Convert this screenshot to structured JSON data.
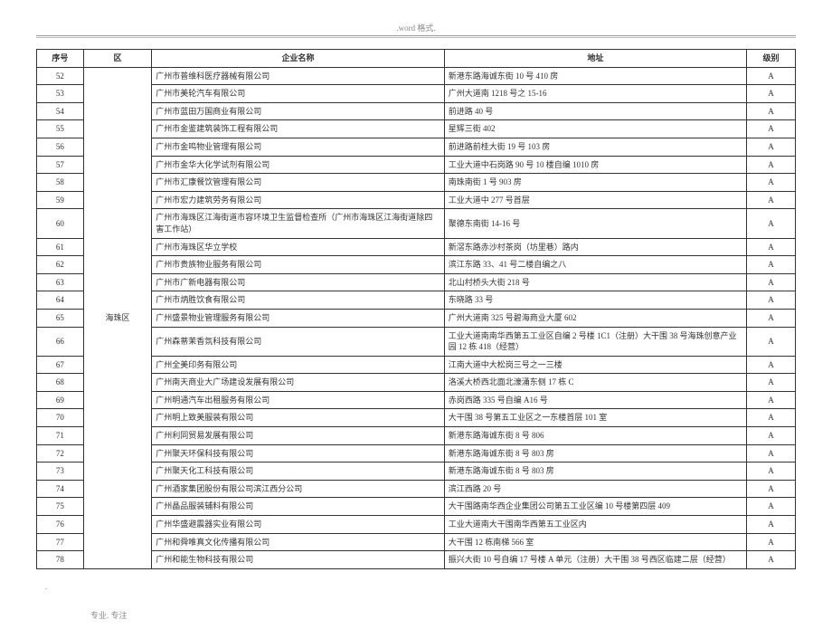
{
  "header_note": ".word 格式.",
  "footer_dot": ".",
  "footer_note": "专业. 专注",
  "columns": {
    "seq": "序号",
    "district": "区",
    "name": "企业名称",
    "addr": "地址",
    "level": "级别"
  },
  "district_label": "海珠区",
  "rows": [
    {
      "seq": "52",
      "name": "广州市普维科医疗器械有限公司",
      "addr": "新港东路海诚东街 10 号 410 房",
      "level": "A"
    },
    {
      "seq": "53",
      "name": "广州市美轮汽车有限公司",
      "addr": "广州大道南 1218 号之 15-16",
      "level": "A"
    },
    {
      "seq": "54",
      "name": "广州市蓝田万国商业有限公司",
      "addr": "前进路 40 号",
      "level": "A"
    },
    {
      "seq": "55",
      "name": "广州市金鉴建筑装饰工程有限公司",
      "addr": "星辉三街 402",
      "level": "A"
    },
    {
      "seq": "56",
      "name": "广州市金鸣物业管理有限公司",
      "addr": "前进路前桂大街 19 号 103 房",
      "level": "A"
    },
    {
      "seq": "57",
      "name": "广州市金华大化学试剂有限公司",
      "addr": "工业大道中石岗路 90 号 10 楼自编 1010 房",
      "level": "A"
    },
    {
      "seq": "58",
      "name": "广州市汇康餐饮管理有限公司",
      "addr": "南珠南街 1 号 903 房",
      "level": "A"
    },
    {
      "seq": "59",
      "name": "广州市宏力建筑劳务有限公司",
      "addr": "工业大道中 277 号首层",
      "level": "A"
    },
    {
      "seq": "60",
      "name": "广州市海珠区江海街道市容环境卫生监督检查所（广州市海珠区江海街道除四害工作站）",
      "addr": "聚德东南街 14-16 号",
      "level": "A"
    },
    {
      "seq": "61",
      "name": "广州市海珠区华立学校",
      "addr": "新滘东路赤沙村茶岗（坊里巷）路内",
      "level": "A"
    },
    {
      "seq": "62",
      "name": "广州市贵族物业服务有限公司",
      "addr": "滨江东路 33、41 号二楼自编之八",
      "level": "A"
    },
    {
      "seq": "63",
      "name": "广州市广新电器有限公司",
      "addr": "北山村桥头大街 218 号",
      "level": "A"
    },
    {
      "seq": "64",
      "name": "广州市炳胜饮食有限公司",
      "addr": "东晓路 33 号",
      "level": "A"
    },
    {
      "seq": "65",
      "name": "广州盛景物业管理服务有限公司",
      "addr": "广州大道南 325 号碧海商业大厦 602",
      "level": "A"
    },
    {
      "seq": "66",
      "name": "广州森蒂茉香氛科技有限公司",
      "addr": "工业大道南南华西第五工业区自编 2 号楼 1C1（注册）大干围 38 号海珠创意产业园 12 栋 418（经营）",
      "level": "A"
    },
    {
      "seq": "67",
      "name": "广州全美印务有限公司",
      "addr": "江南大道中大松岗三号之一三楼",
      "level": "A"
    },
    {
      "seq": "68",
      "name": "广州南天商业大广场建设发展有限公司",
      "addr": "洛溪大桥西北面北濠涌东侧 17 栋 C",
      "level": "A"
    },
    {
      "seq": "69",
      "name": "广州明通汽车出租服务有限公司",
      "addr": "赤岗西路 335 号自编 A16 号",
      "level": "A"
    },
    {
      "seq": "70",
      "name": "广州明上致美服装有限公司",
      "addr": "大干围 38 号第五工业区之一东楼首层 101 室",
      "level": "A"
    },
    {
      "seq": "71",
      "name": "广州利同贸易发展有限公司",
      "addr": "新港东路海诚东街 8 号 806",
      "level": "A"
    },
    {
      "seq": "72",
      "name": "广州聚天环保科技有限公司",
      "addr": "新港东路海诚东街 8 号 803 房",
      "level": "A"
    },
    {
      "seq": "73",
      "name": "广州聚天化工科技有限公司",
      "addr": "新港东路海诚东街 8 号 803 房",
      "level": "A"
    },
    {
      "seq": "74",
      "name": "广州酒家集团股份有限公司滨江西分公司",
      "addr": "滨江西路 20 号",
      "level": "A"
    },
    {
      "seq": "75",
      "name": "广州晶品服装辅料有限公司",
      "addr": "大干围路南华西企业集团公司第五工业区编 10 号楼第四层 409",
      "level": "A"
    },
    {
      "seq": "76",
      "name": "广州华盛避震器实业有限公司",
      "addr": "工业大道南大干围南华西第五工业区内",
      "level": "A"
    },
    {
      "seq": "77",
      "name": "广州和舜唯真文化传播有限公司",
      "addr": "大干围 12 栋南梯 566 室",
      "level": "A"
    },
    {
      "seq": "78",
      "name": "广州和能生物科技有限公司",
      "addr": "振兴大街 10 号自编 17 号楼 A 单元（注册）大干围 38 号西区临建二层（经营）",
      "level": "A"
    }
  ]
}
